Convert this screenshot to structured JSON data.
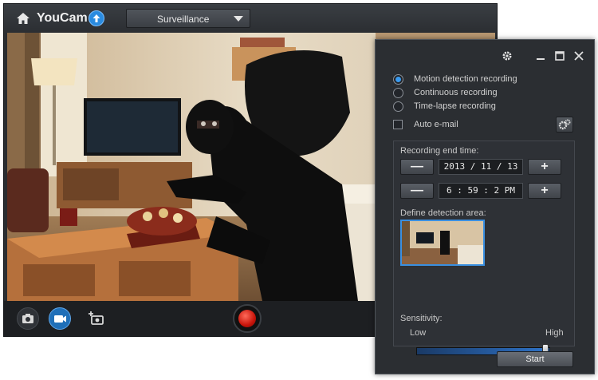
{
  "app": {
    "title": "YouCam"
  },
  "header": {
    "mode_selected": "Surveillance"
  },
  "bottom_bar": {
    "record_state": "idle"
  },
  "dialog": {
    "recording_modes": [
      {
        "label": "Motion detection recording",
        "selected": true
      },
      {
        "label": "Continuous recording",
        "selected": false
      },
      {
        "label": "Time-lapse recording",
        "selected": false
      }
    ],
    "auto_email_label": "Auto e-mail",
    "auto_email_checked": false,
    "recording_end_time_label": "Recording end time:",
    "date_value": "2013 / 11 / 13",
    "time_value": "6 : 59 : 2   PM",
    "minus_label": "—",
    "plus_label": "+",
    "detection_area_label": "Define detection area:",
    "sensitivity_label": "Sensitivity:",
    "sensitivity_low": "Low",
    "sensitivity_high": "High",
    "sensitivity_level": 0.97,
    "start_label": "Start"
  },
  "colors": {
    "accent": "#2e73c9",
    "record": "#c8140a"
  }
}
